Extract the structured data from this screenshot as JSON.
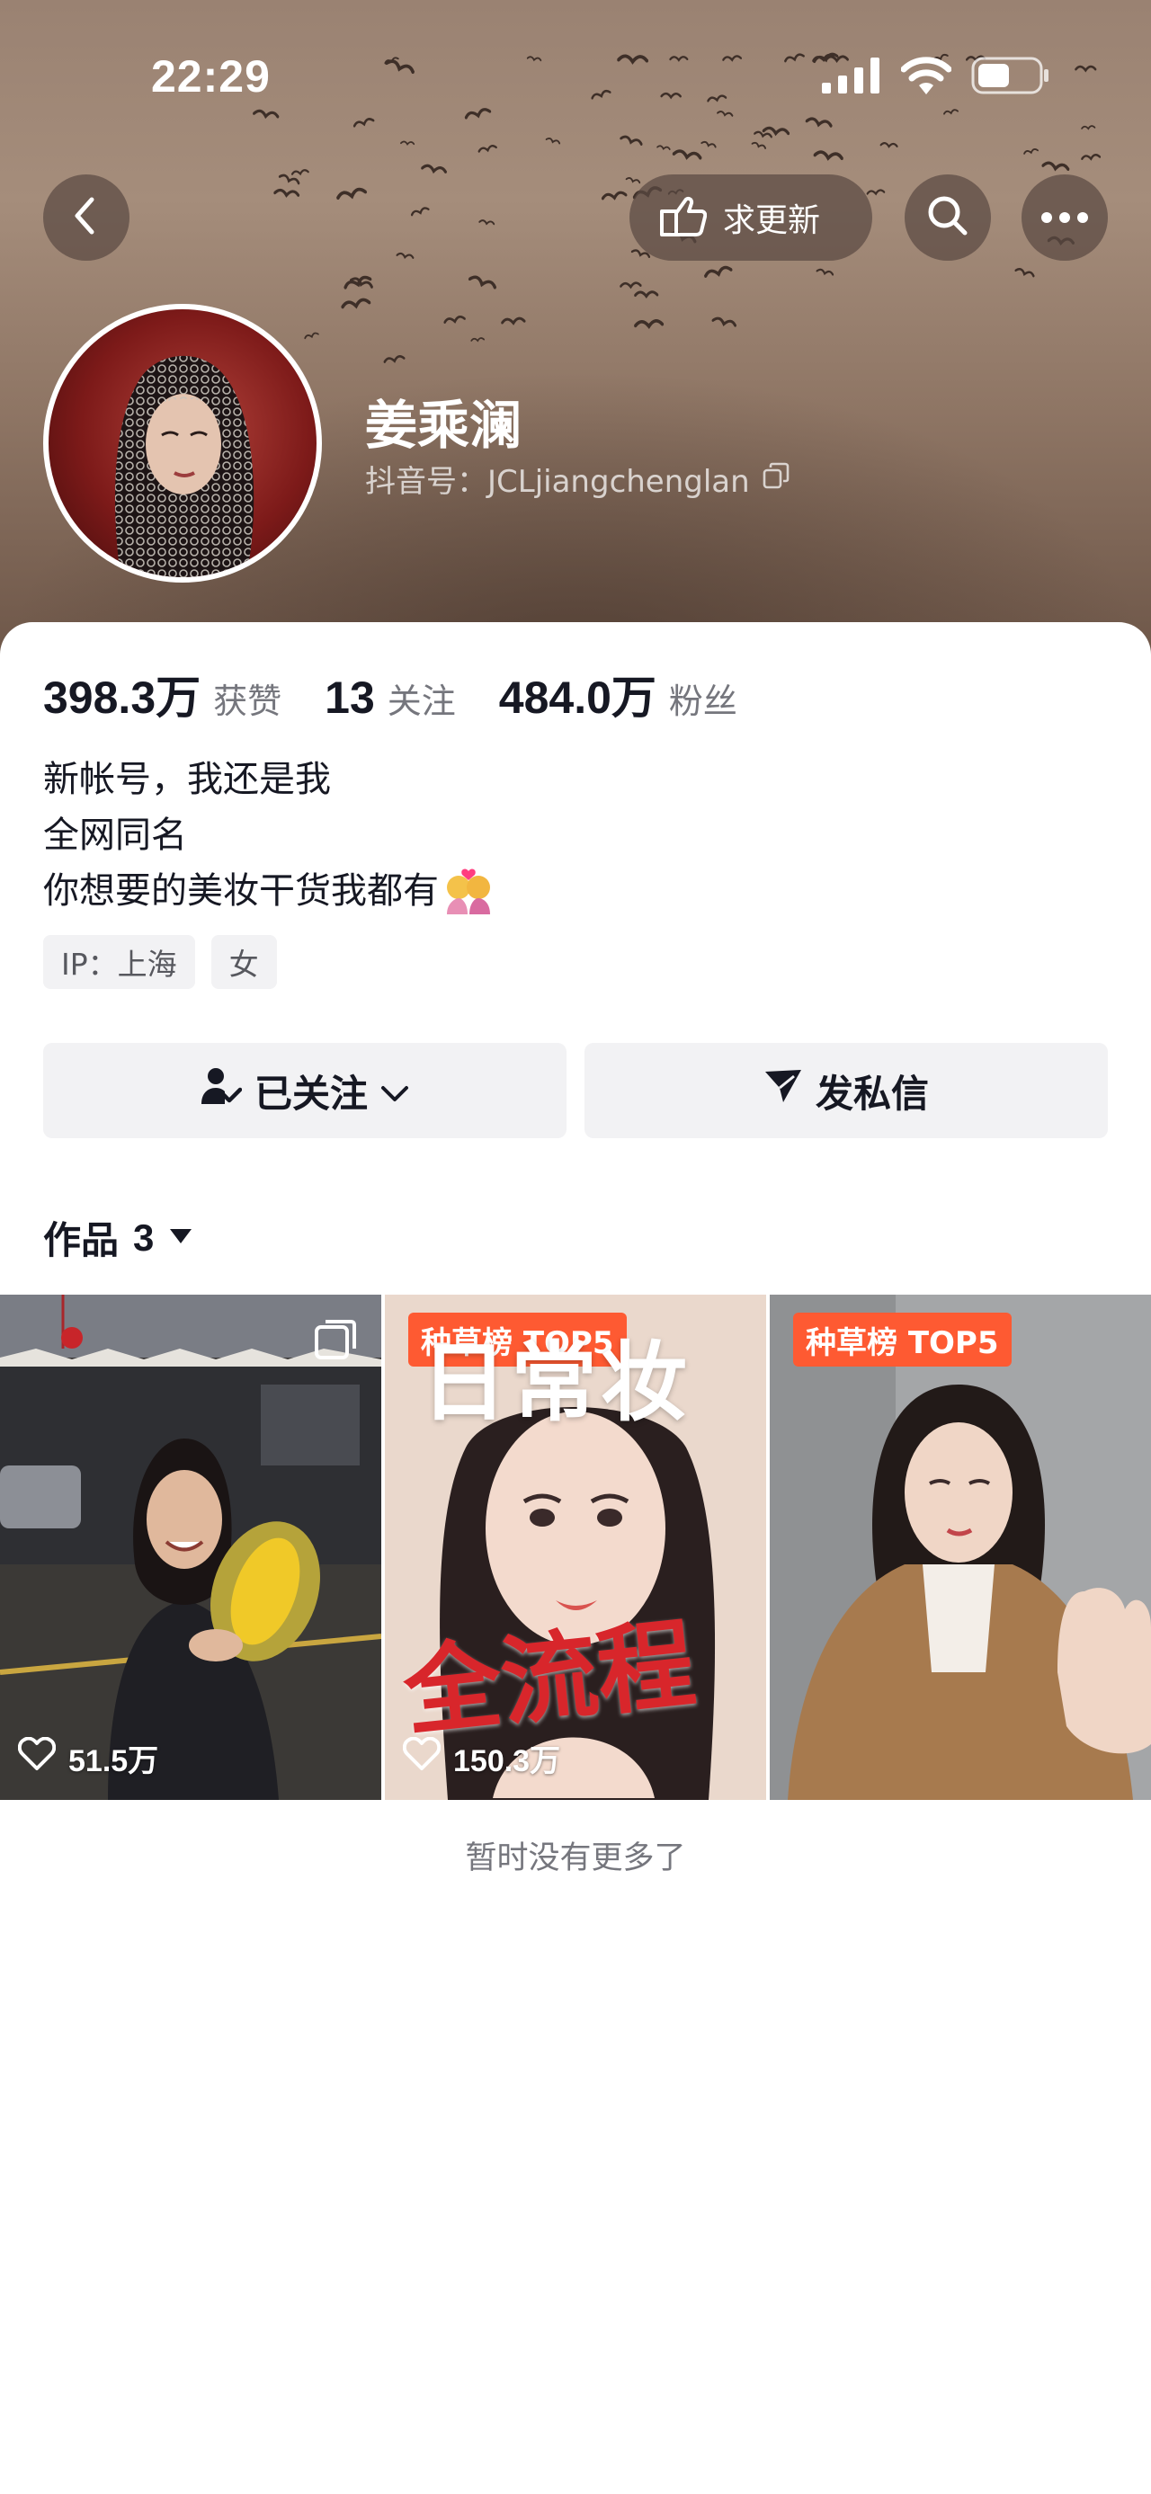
{
  "status_bar": {
    "time": "22:29"
  },
  "header": {
    "update_label": "求更新",
    "name": "姜乘澜",
    "douyin_id": "抖音号：JCLjiangchenglan"
  },
  "stats": [
    {
      "value": "398.3万",
      "label": "获赞"
    },
    {
      "value": "13",
      "label": "关注"
    },
    {
      "value": "484.0万",
      "label": "粉丝"
    }
  ],
  "bio": {
    "line1": "新帐号，我还是我",
    "line2": "全网同名",
    "line3": "你想要的美妆干货我都有"
  },
  "tags": [
    "IP：上海",
    "女"
  ],
  "actions": {
    "follow": "已关注",
    "message": "发私信"
  },
  "works": {
    "title": "作品",
    "count": "3",
    "items": [
      {
        "likes": "51.5万",
        "badge": ""
      },
      {
        "likes": "150.3万",
        "badge": "种草榜 TOP5",
        "overlay_top": "日常妆",
        "overlay_bottom": "全流程"
      },
      {
        "likes": "",
        "badge": "种草榜 TOP5"
      }
    ],
    "end_text": "暂时没有更多了"
  },
  "colors": {
    "badge": "#fe5a32",
    "hero": "#9a8272",
    "button_bg": "#f2f2f4"
  },
  "icons": [
    "back-icon",
    "hand-pointer-icon",
    "search-icon",
    "more-icon",
    "copy-icon",
    "follow-check-icon",
    "chevron-down-icon",
    "send-icon",
    "triangle-down-icon",
    "heart-icon",
    "multi-image-icon",
    "signal-icon",
    "wifi-icon",
    "battery-icon"
  ]
}
